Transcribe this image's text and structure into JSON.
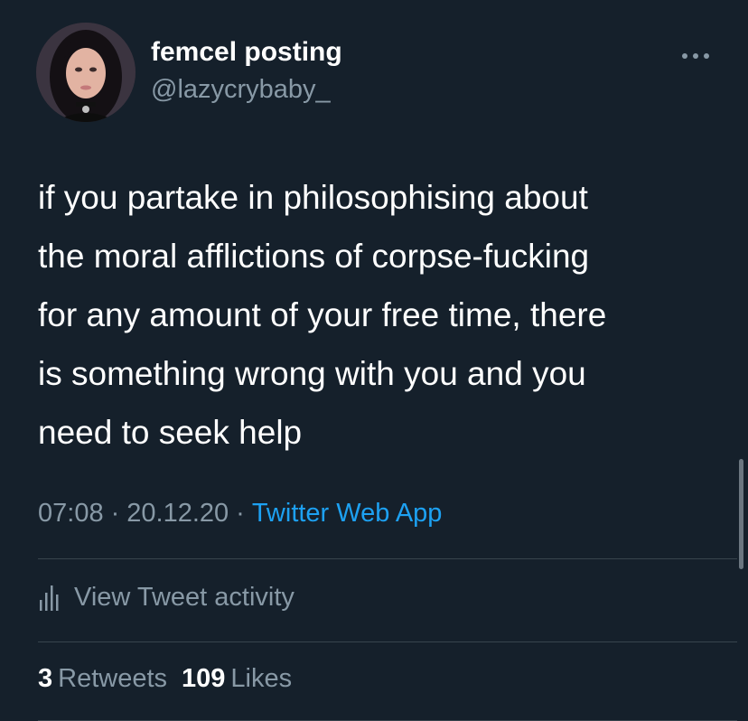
{
  "user": {
    "display_name": "femcel posting",
    "handle": "@lazycrybaby_"
  },
  "tweet": {
    "text": "if you partake in philosophising about\nthe moral afflictions of corpse-fucking\nfor any amount of your free time, there\nis something wrong with you and you\nneed to seek help",
    "time": "07:08",
    "separator": "·",
    "date": "20.12.20",
    "source": "Twitter Web App"
  },
  "activity": {
    "label": "View Tweet activity",
    "icon": "bar-chart-icon"
  },
  "stats": {
    "retweets_count": "3",
    "retweets_label": "Retweets",
    "likes_count": "109",
    "likes_label": "Likes"
  },
  "colors": {
    "background": "#15202b",
    "primary_text": "#ffffff",
    "secondary_text": "#8899a6",
    "link": "#1da1f2",
    "divider": "#38444d"
  }
}
